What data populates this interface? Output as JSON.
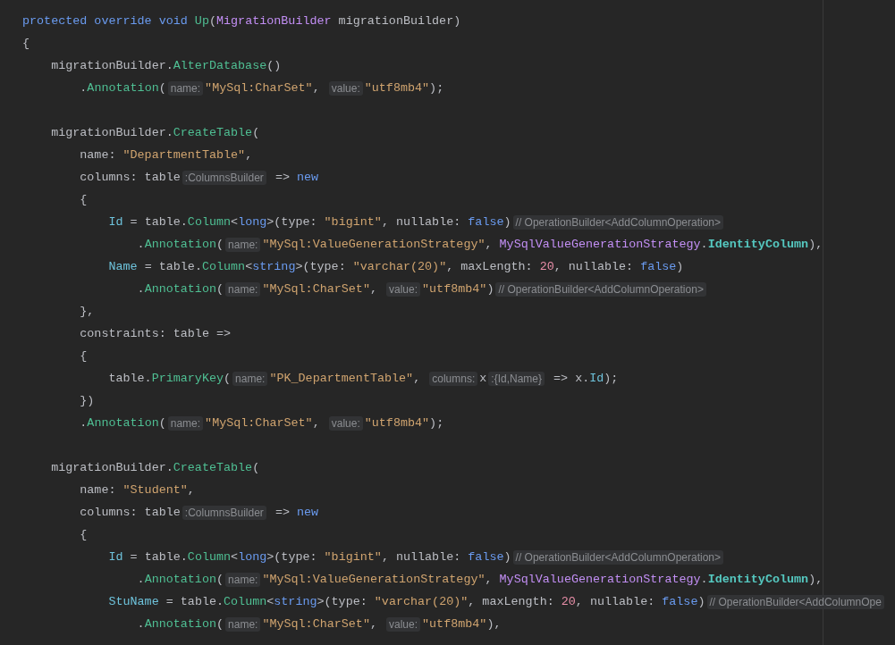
{
  "editor": {
    "lines": [
      {
        "kind": "code",
        "tokens": [
          {
            "kind": "kw",
            "text": "protected override void "
          },
          {
            "kind": "fn",
            "text": "Up"
          },
          {
            "kind": "text",
            "text": "("
          },
          {
            "kind": "type",
            "text": "MigrationBuilder"
          },
          {
            "kind": "text",
            "text": " migrationBuilder)"
          }
        ]
      },
      {
        "kind": "code",
        "tokens": [
          {
            "kind": "text",
            "text": "{"
          }
        ]
      },
      {
        "kind": "code",
        "tokens": [
          {
            "kind": "text",
            "text": "    migrationBuilder."
          },
          {
            "kind": "fn",
            "text": "AlterDatabase"
          },
          {
            "kind": "text",
            "text": "()"
          }
        ]
      },
      {
        "kind": "code",
        "tokens": [
          {
            "kind": "text",
            "text": "        ."
          },
          {
            "kind": "fn",
            "text": "Annotation"
          },
          {
            "kind": "text",
            "text": "("
          },
          {
            "kind": "hint",
            "text": "name:"
          },
          {
            "kind": "str",
            "text": "\"MySql:CharSet\""
          },
          {
            "kind": "text",
            "text": ", "
          },
          {
            "kind": "hint",
            "text": "value:"
          },
          {
            "kind": "str",
            "text": "\"utf8mb4\""
          },
          {
            "kind": "text",
            "text": ");"
          }
        ]
      },
      {
        "kind": "blank"
      },
      {
        "kind": "code",
        "tokens": [
          {
            "kind": "text",
            "text": "    migrationBuilder."
          },
          {
            "kind": "fn",
            "text": "CreateTable"
          },
          {
            "kind": "text",
            "text": "("
          }
        ]
      },
      {
        "kind": "code",
        "tokens": [
          {
            "kind": "text",
            "text": "        name: "
          },
          {
            "kind": "str",
            "text": "\"DepartmentTable\""
          },
          {
            "kind": "text",
            "text": ","
          }
        ]
      },
      {
        "kind": "code",
        "tokens": [
          {
            "kind": "text",
            "text": "        columns: table"
          },
          {
            "kind": "hint",
            "text": ":ColumnsBuilder"
          },
          {
            "kind": "text",
            "text": " => "
          },
          {
            "kind": "kw",
            "text": "new"
          }
        ]
      },
      {
        "kind": "code",
        "tokens": [
          {
            "kind": "text",
            "text": "        {"
          }
        ]
      },
      {
        "kind": "code",
        "tokens": [
          {
            "kind": "prop",
            "text": "            Id"
          },
          {
            "kind": "text",
            "text": " = table."
          },
          {
            "kind": "fn",
            "text": "Column"
          },
          {
            "kind": "text",
            "text": "<"
          },
          {
            "kind": "kw",
            "text": "long"
          },
          {
            "kind": "text",
            "text": ">(type: "
          },
          {
            "kind": "str",
            "text": "\"bigint\""
          },
          {
            "kind": "text",
            "text": ", nullable: "
          },
          {
            "kind": "kw",
            "text": "false"
          },
          {
            "kind": "text",
            "text": ")"
          },
          {
            "kind": "hint",
            "text": "// OperationBuilder<AddColumnOperation>"
          }
        ]
      },
      {
        "kind": "code",
        "tokens": [
          {
            "kind": "text",
            "text": "                ."
          },
          {
            "kind": "fn",
            "text": "Annotation"
          },
          {
            "kind": "text",
            "text": "("
          },
          {
            "kind": "hint",
            "text": "name:"
          },
          {
            "kind": "str",
            "text": "\"MySql:ValueGenerationStrategy\""
          },
          {
            "kind": "text",
            "text": ", "
          },
          {
            "kind": "type",
            "text": "MySqlValueGenerationStrategy"
          },
          {
            "kind": "text",
            "text": "."
          },
          {
            "kind": "enum",
            "text": "IdentityColumn"
          },
          {
            "kind": "text",
            "text": "),"
          }
        ]
      },
      {
        "kind": "code",
        "tokens": [
          {
            "kind": "prop",
            "text": "            Name"
          },
          {
            "kind": "text",
            "text": " = table."
          },
          {
            "kind": "fn",
            "text": "Column"
          },
          {
            "kind": "text",
            "text": "<"
          },
          {
            "kind": "kw",
            "text": "string"
          },
          {
            "kind": "text",
            "text": ">(type: "
          },
          {
            "kind": "str",
            "text": "\"varchar(20)\""
          },
          {
            "kind": "text",
            "text": ", maxLength: "
          },
          {
            "kind": "num",
            "text": "20"
          },
          {
            "kind": "text",
            "text": ", nullable: "
          },
          {
            "kind": "kw",
            "text": "false"
          },
          {
            "kind": "text",
            "text": ")"
          }
        ]
      },
      {
        "kind": "code",
        "tokens": [
          {
            "kind": "text",
            "text": "                ."
          },
          {
            "kind": "fn",
            "text": "Annotation"
          },
          {
            "kind": "text",
            "text": "("
          },
          {
            "kind": "hint",
            "text": "name:"
          },
          {
            "kind": "str",
            "text": "\"MySql:CharSet\""
          },
          {
            "kind": "text",
            "text": ", "
          },
          {
            "kind": "hint",
            "text": "value:"
          },
          {
            "kind": "str",
            "text": "\"utf8mb4\""
          },
          {
            "kind": "text",
            "text": ")"
          },
          {
            "kind": "hint",
            "text": "// OperationBuilder<AddColumnOperation>"
          }
        ]
      },
      {
        "kind": "code",
        "tokens": [
          {
            "kind": "text",
            "text": "        },"
          }
        ]
      },
      {
        "kind": "code",
        "tokens": [
          {
            "kind": "text",
            "text": "        constraints: table =>"
          }
        ]
      },
      {
        "kind": "code",
        "tokens": [
          {
            "kind": "text",
            "text": "        {"
          }
        ]
      },
      {
        "kind": "code",
        "tokens": [
          {
            "kind": "text",
            "text": "            table."
          },
          {
            "kind": "fn",
            "text": "PrimaryKey"
          },
          {
            "kind": "text",
            "text": "("
          },
          {
            "kind": "hint",
            "text": "name:"
          },
          {
            "kind": "str",
            "text": "\"PK_DepartmentTable\""
          },
          {
            "kind": "text",
            "text": ", "
          },
          {
            "kind": "hint",
            "text": "columns:"
          },
          {
            "kind": "text",
            "text": "x"
          },
          {
            "kind": "hint",
            "text": ":{Id,Name}"
          },
          {
            "kind": "text",
            "text": " => x."
          },
          {
            "kind": "prop",
            "text": "Id"
          },
          {
            "kind": "text",
            "text": ");"
          }
        ]
      },
      {
        "kind": "code",
        "tokens": [
          {
            "kind": "text",
            "text": "        })"
          }
        ]
      },
      {
        "kind": "code",
        "tokens": [
          {
            "kind": "text",
            "text": "        ."
          },
          {
            "kind": "fn",
            "text": "Annotation"
          },
          {
            "kind": "text",
            "text": "("
          },
          {
            "kind": "hint",
            "text": "name:"
          },
          {
            "kind": "str",
            "text": "\"MySql:CharSet\""
          },
          {
            "kind": "text",
            "text": ", "
          },
          {
            "kind": "hint",
            "text": "value:"
          },
          {
            "kind": "str",
            "text": "\"utf8mb4\""
          },
          {
            "kind": "text",
            "text": ");"
          }
        ]
      },
      {
        "kind": "blank"
      },
      {
        "kind": "code",
        "tokens": [
          {
            "kind": "text",
            "text": "    migrationBuilder."
          },
          {
            "kind": "fn",
            "text": "CreateTable"
          },
          {
            "kind": "text",
            "text": "("
          }
        ]
      },
      {
        "kind": "code",
        "tokens": [
          {
            "kind": "text",
            "text": "        name: "
          },
          {
            "kind": "str",
            "text": "\"Student\""
          },
          {
            "kind": "text",
            "text": ","
          }
        ]
      },
      {
        "kind": "code",
        "tokens": [
          {
            "kind": "text",
            "text": "        columns: table"
          },
          {
            "kind": "hint",
            "text": ":ColumnsBuilder"
          },
          {
            "kind": "text",
            "text": " => "
          },
          {
            "kind": "kw",
            "text": "new"
          }
        ]
      },
      {
        "kind": "code",
        "tokens": [
          {
            "kind": "text",
            "text": "        {"
          }
        ]
      },
      {
        "kind": "code",
        "tokens": [
          {
            "kind": "prop",
            "text": "            Id"
          },
          {
            "kind": "text",
            "text": " = table."
          },
          {
            "kind": "fn",
            "text": "Column"
          },
          {
            "kind": "text",
            "text": "<"
          },
          {
            "kind": "kw",
            "text": "long"
          },
          {
            "kind": "text",
            "text": ">(type: "
          },
          {
            "kind": "str",
            "text": "\"bigint\""
          },
          {
            "kind": "text",
            "text": ", nullable: "
          },
          {
            "kind": "kw",
            "text": "false"
          },
          {
            "kind": "text",
            "text": ")"
          },
          {
            "kind": "hint",
            "text": "// OperationBuilder<AddColumnOperation>"
          }
        ]
      },
      {
        "kind": "code",
        "tokens": [
          {
            "kind": "text",
            "text": "                ."
          },
          {
            "kind": "fn",
            "text": "Annotation"
          },
          {
            "kind": "text",
            "text": "("
          },
          {
            "kind": "hint",
            "text": "name:"
          },
          {
            "kind": "str",
            "text": "\"MySql:ValueGenerationStrategy\""
          },
          {
            "kind": "text",
            "text": ", "
          },
          {
            "kind": "type",
            "text": "MySqlValueGenerationStrategy"
          },
          {
            "kind": "text",
            "text": "."
          },
          {
            "kind": "enum",
            "text": "IdentityColumn"
          },
          {
            "kind": "text",
            "text": "),"
          }
        ]
      },
      {
        "kind": "code",
        "tokens": [
          {
            "kind": "prop",
            "text": "            StuName"
          },
          {
            "kind": "text",
            "text": " = table."
          },
          {
            "kind": "fn",
            "text": "Column"
          },
          {
            "kind": "text",
            "text": "<"
          },
          {
            "kind": "kw",
            "text": "string"
          },
          {
            "kind": "text",
            "text": ">(type: "
          },
          {
            "kind": "str",
            "text": "\"varchar(20)\""
          },
          {
            "kind": "text",
            "text": ", maxLength: "
          },
          {
            "kind": "num",
            "text": "20"
          },
          {
            "kind": "text",
            "text": ", nullable: "
          },
          {
            "kind": "kw",
            "text": "false"
          },
          {
            "kind": "text",
            "text": ")"
          },
          {
            "kind": "hint",
            "text": "// OperationBuilder<AddColumnOpe"
          }
        ]
      },
      {
        "kind": "code",
        "tokens": [
          {
            "kind": "text",
            "text": "                ."
          },
          {
            "kind": "fn",
            "text": "Annotation"
          },
          {
            "kind": "text",
            "text": "("
          },
          {
            "kind": "hint",
            "text": "name:"
          },
          {
            "kind": "str",
            "text": "\"MySql:CharSet\""
          },
          {
            "kind": "text",
            "text": ", "
          },
          {
            "kind": "hint",
            "text": "value:"
          },
          {
            "kind": "str",
            "text": "\"utf8mb4\""
          },
          {
            "kind": "text",
            "text": "),"
          }
        ]
      }
    ]
  }
}
